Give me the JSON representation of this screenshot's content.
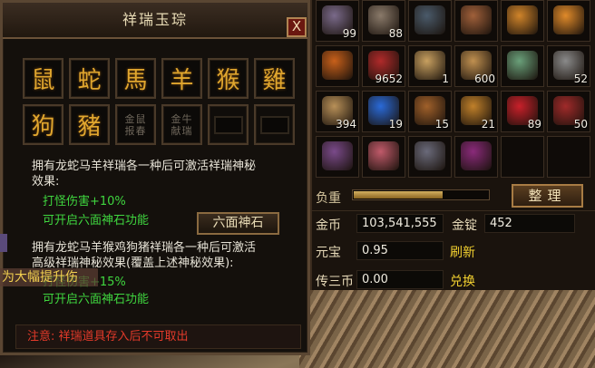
{
  "dialog": {
    "title": "祥瑞玉琮",
    "close_label": "X",
    "zodiacs": [
      {
        "name": "鼠",
        "glyph": "鼠",
        "state": "active"
      },
      {
        "name": "蛇",
        "glyph": "蛇",
        "state": "active"
      },
      {
        "name": "马",
        "glyph": "馬",
        "state": "active"
      },
      {
        "name": "羊",
        "glyph": "羊",
        "state": "active"
      },
      {
        "name": "猴",
        "glyph": "猴",
        "state": "active"
      },
      {
        "name": "鸡",
        "glyph": "雞",
        "state": "active"
      },
      {
        "name": "狗",
        "glyph": "狗",
        "state": "active"
      },
      {
        "name": "猪",
        "glyph": "豬",
        "state": "active"
      },
      {
        "name": "金鼠报春",
        "label": "金鼠\n报春",
        "state": "locked"
      },
      {
        "name": "金牛献瑞",
        "label": "金牛\n献瑞",
        "state": "locked"
      },
      {
        "name": "空",
        "state": "empty"
      },
      {
        "name": "空",
        "state": "empty"
      }
    ],
    "effect1_line1": "拥有龙蛇马羊祥瑞各一种后可激活祥瑞神秘",
    "effect1_line2": "效果:",
    "effect1_stat": "打怪伤害+10%",
    "effect1_unlock": "可开启六面神石功能",
    "six_button": "六面神石",
    "effect2_line1": "拥有龙蛇马羊猴鸡狗猪祥瑞各一种后可激活",
    "effect2_line2": "高级祥瑞神秘效果(覆盖上述神秘效果):",
    "effect2_stat": "打怪伤害+15%",
    "effect2_unlock": "可开启六面神石功能",
    "note": "注意: 祥瑞道具存入后不可取出"
  },
  "overlay": {
    "side_text": "为大幅提升伤"
  },
  "bag": {
    "items": [
      {
        "name": "卷轴",
        "count": "99",
        "color": "#7a6a8a"
      },
      {
        "name": "卷轴",
        "count": "88",
        "color": "#8a7a6a"
      },
      {
        "name": "宝袋",
        "count": "",
        "color": "#4a5a6a"
      },
      {
        "name": "宝袋",
        "count": "",
        "color": "#a0603a"
      },
      {
        "name": "令牌",
        "count": "",
        "color": "#d0842a"
      },
      {
        "name": "令牌",
        "count": "",
        "color": "#e08a2a"
      },
      {
        "name": "令牌",
        "count": "",
        "color": "#c8601a"
      },
      {
        "name": "红包",
        "count": "9652",
        "color": "#b02a2a"
      },
      {
        "name": "卷轴",
        "count": "1",
        "color": "#c8a060"
      },
      {
        "name": "卷轴",
        "count": "600",
        "color": "#c09050"
      },
      {
        "name": "玉石",
        "count": "",
        "color": "#6aa07a"
      },
      {
        "name": "镐",
        "count": "52",
        "color": "#8a8a8a"
      },
      {
        "name": "卷轴",
        "count": "394",
        "color": "#b89058"
      },
      {
        "name": "宝石",
        "count": "19",
        "color": "#2a6ad8"
      },
      {
        "name": "药瓶",
        "count": "15",
        "color": "#a0602a"
      },
      {
        "name": "药瓶",
        "count": "21",
        "color": "#c0802a"
      },
      {
        "name": "果实",
        "count": "89",
        "color": "#c8202a"
      },
      {
        "name": "药袋",
        "count": "50",
        "color": "#a02a2a"
      },
      {
        "name": "符石",
        "count": "",
        "color": "#7a4a8a"
      },
      {
        "name": "符石",
        "count": "",
        "color": "#c05a6a"
      },
      {
        "name": "符石",
        "count": "",
        "color": "#6a6a7a"
      },
      {
        "name": "药瓶",
        "count": "",
        "color": "#8a2a7a"
      },
      {
        "name": "空",
        "count": "",
        "color": ""
      },
      {
        "name": "空",
        "count": "",
        "color": ""
      }
    ],
    "weight_label": "负重",
    "weight_fraction": 0.66,
    "sort_button": "整理",
    "gold_label": "金币",
    "gold_value": "103,541,555",
    "ingot_label": "金锭",
    "ingot_value": "452",
    "yuanbao_label": "元宝",
    "yuanbao_value": "0.95",
    "refresh_label": "刷新",
    "coin_label": "传三币",
    "coin_value": "0.00",
    "exchange_label": "兑换"
  }
}
